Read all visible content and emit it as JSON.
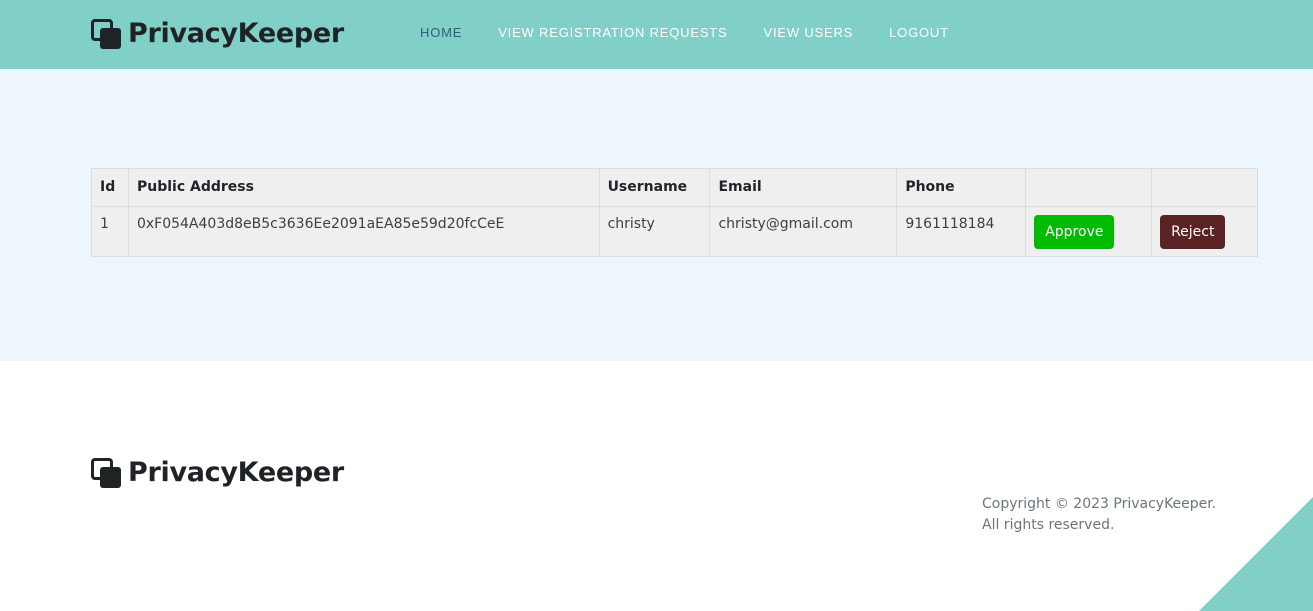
{
  "header": {
    "brand": "PrivacyKeeper",
    "nav": [
      {
        "label": "HOME"
      },
      {
        "label": "VIEW REGISTRATION REQUESTS"
      },
      {
        "label": "VIEW USERS"
      },
      {
        "label": "LOGOUT"
      }
    ]
  },
  "table": {
    "columns": [
      "Id",
      "Public Address",
      "Username",
      "Email",
      "Phone",
      "",
      ""
    ],
    "rows": [
      {
        "id": "1",
        "public_address": "0xF054A403d8eB5c3636Ee2091aEA85e59d20fcCeE",
        "username": "christy",
        "email": "christy@gmail.com",
        "phone": "9161118184",
        "approve_label": "Approve",
        "reject_label": "Reject"
      }
    ]
  },
  "footer": {
    "brand": "PrivacyKeeper",
    "copyright": "Copyright © 2023 PrivacyKeeper. All rights reserved."
  },
  "colors": {
    "header_bg": "#80d0c7",
    "main_bg": "#eef6fd",
    "approve": "#00bb00",
    "reject": "#5a2222",
    "nav_active": "#2f5d78"
  },
  "icons": {
    "logo": "two-overlapping-squares-icon"
  }
}
